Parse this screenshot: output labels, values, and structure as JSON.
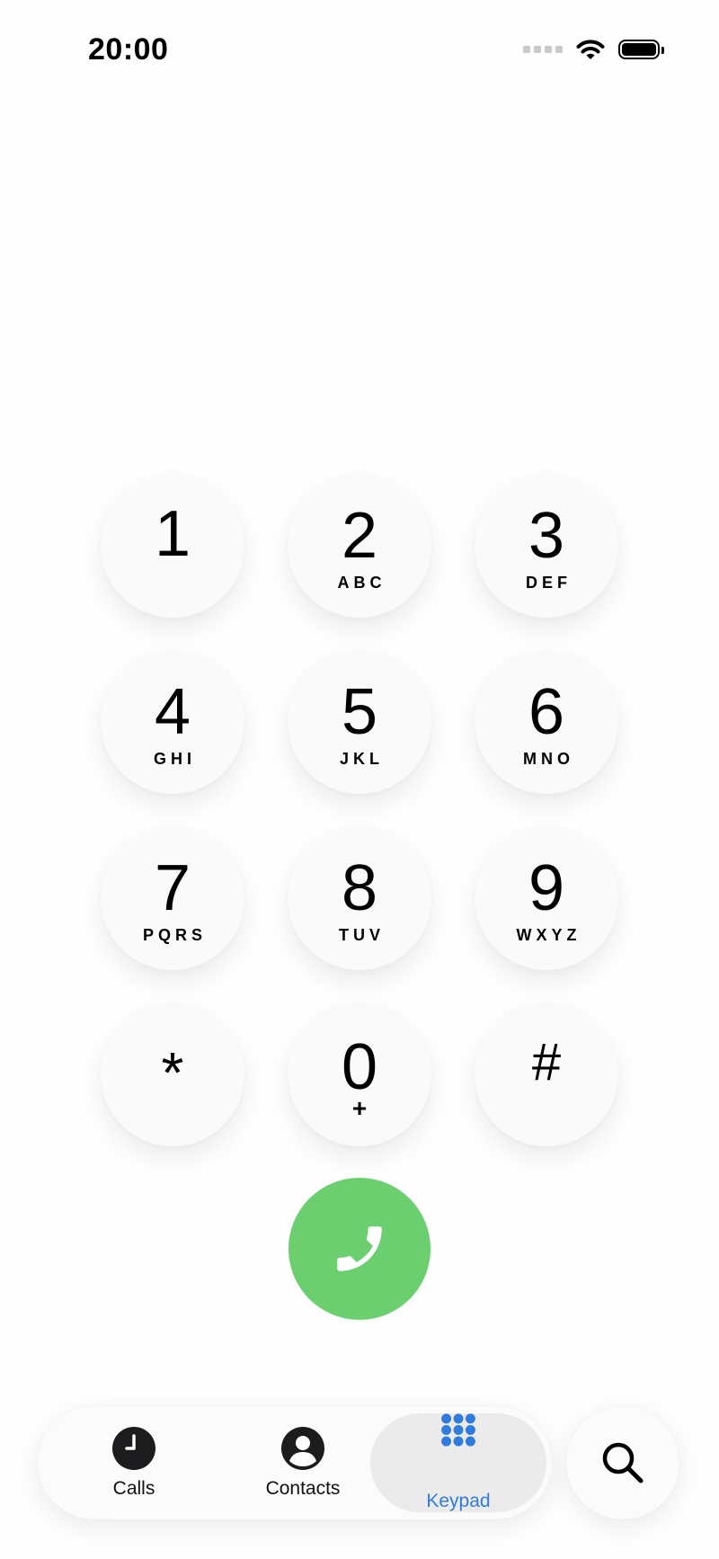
{
  "status_bar": {
    "time": "20:00",
    "wifi_icon": "wifi-icon",
    "battery_icon": "battery-full-icon"
  },
  "keypad": {
    "keys": [
      {
        "digit": "1",
        "letters": ""
      },
      {
        "digit": "2",
        "letters": "ABC"
      },
      {
        "digit": "3",
        "letters": "DEF"
      },
      {
        "digit": "4",
        "letters": "GHI"
      },
      {
        "digit": "5",
        "letters": "JKL"
      },
      {
        "digit": "6",
        "letters": "MNO"
      },
      {
        "digit": "7",
        "letters": "PQRS"
      },
      {
        "digit": "8",
        "letters": "TUV"
      },
      {
        "digit": "9",
        "letters": "WXYZ"
      },
      {
        "digit": "*",
        "letters": ""
      },
      {
        "digit": "0",
        "letters": "+"
      },
      {
        "digit": "#",
        "letters": ""
      }
    ]
  },
  "call_button": {
    "icon": "phone-icon",
    "color": "#6ccf6f"
  },
  "tabbar": {
    "tabs": [
      {
        "label": "Calls",
        "icon": "clock-icon",
        "selected": false
      },
      {
        "label": "Contacts",
        "icon": "person-circle-icon",
        "selected": false
      },
      {
        "label": "Keypad",
        "icon": "keypad-grid-icon",
        "selected": true
      }
    ],
    "accent_color": "#2f7be0",
    "search_icon": "search-icon"
  }
}
